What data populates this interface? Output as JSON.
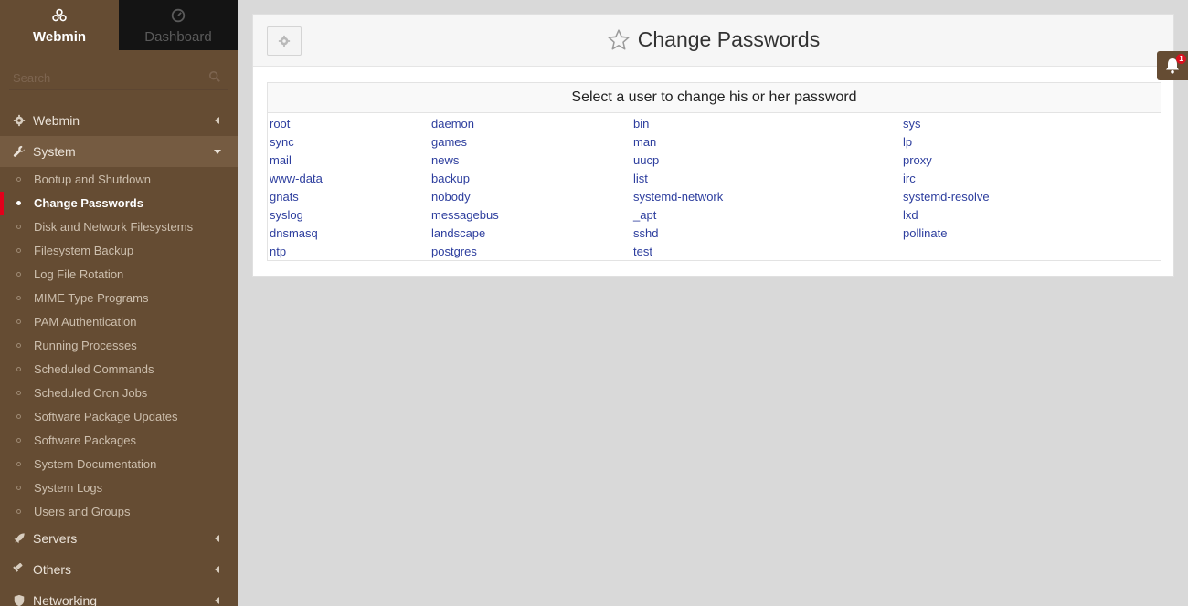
{
  "sidebar": {
    "tabs": [
      {
        "label": "Webmin",
        "icon": "webmin-logo-icon",
        "active": true
      },
      {
        "label": "Dashboard",
        "icon": "dashboard-gauge-icon",
        "active": false
      }
    ],
    "search": {
      "placeholder": "Search",
      "value": ""
    },
    "sections": [
      {
        "label": "Webmin",
        "icon": "gear-icon",
        "open": false
      },
      {
        "label": "System",
        "icon": "wrench-icon",
        "open": true
      },
      {
        "label": "Servers",
        "icon": "rocket-icon",
        "open": false
      },
      {
        "label": "Others",
        "icon": "hammer-icon",
        "open": false
      },
      {
        "label": "Networking",
        "icon": "shield-icon",
        "open": false
      }
    ],
    "system_items": [
      "Bootup and Shutdown",
      "Change Passwords",
      "Disk and Network Filesystems",
      "Filesystem Backup",
      "Log File Rotation",
      "MIME Type Programs",
      "PAM Authentication",
      "Running Processes",
      "Scheduled Commands",
      "Scheduled Cron Jobs",
      "Software Package Updates",
      "Software Packages",
      "System Documentation",
      "System Logs",
      "Users and Groups"
    ],
    "active_item": "Change Passwords"
  },
  "main": {
    "title": "Change Passwords",
    "prompt": "Select a user to change his or her password",
    "users": [
      [
        "root",
        "daemon",
        "bin",
        "sys"
      ],
      [
        "sync",
        "games",
        "man",
        "lp"
      ],
      [
        "mail",
        "news",
        "uucp",
        "proxy"
      ],
      [
        "www-data",
        "backup",
        "list",
        "irc"
      ],
      [
        "gnats",
        "nobody",
        "systemd-network",
        "systemd-resolve"
      ],
      [
        "syslog",
        "messagebus",
        "_apt",
        "lxd"
      ],
      [
        "dnsmasq",
        "landscape",
        "sshd",
        "pollinate"
      ],
      [
        "ntp",
        "postgres",
        "test",
        ""
      ]
    ]
  },
  "notifications": {
    "count": "1"
  },
  "colors": {
    "sidebar_bg": "#654c33",
    "link": "#2d3e9e",
    "active_marker": "#e3001b"
  }
}
